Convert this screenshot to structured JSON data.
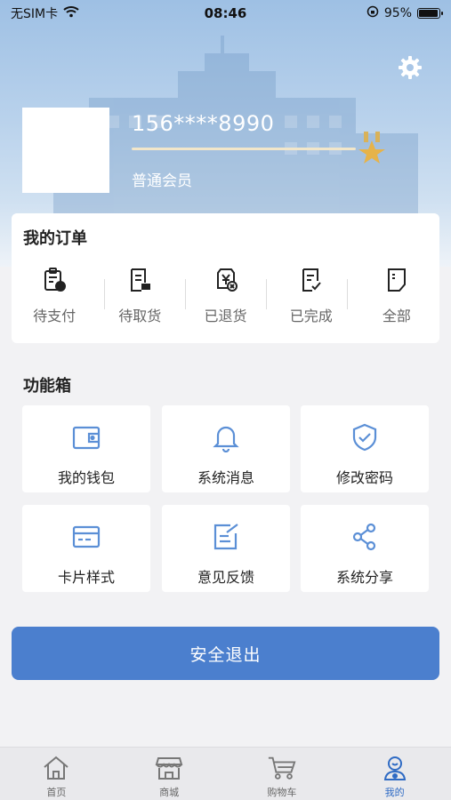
{
  "status_bar": {
    "carrier": "无SIM卡",
    "time": "08:46",
    "battery": "95%",
    "battery_level": 0.95
  },
  "profile": {
    "phone": "156****8990",
    "member_level": "普通会员"
  },
  "orders": {
    "title": "我的订单",
    "items": [
      {
        "label": "待支付",
        "icon": "pay-clipboard-icon"
      },
      {
        "label": "待取货",
        "icon": "pickup-list-icon"
      },
      {
        "label": "已退货",
        "icon": "refund-icon"
      },
      {
        "label": "已完成",
        "icon": "completed-doc-icon"
      },
      {
        "label": "全部",
        "icon": "all-doc-icon"
      }
    ]
  },
  "functions": {
    "title": "功能箱",
    "items": [
      {
        "label": "我的钱包",
        "icon": "wallet-icon"
      },
      {
        "label": "系统消息",
        "icon": "bell-icon"
      },
      {
        "label": "修改密码",
        "icon": "shield-check-icon"
      },
      {
        "label": "卡片样式",
        "icon": "card-icon"
      },
      {
        "label": "意见反馈",
        "icon": "feedback-edit-icon"
      },
      {
        "label": "系统分享",
        "icon": "share-icon"
      }
    ]
  },
  "logout_label": "安全退出",
  "tabs": [
    {
      "label": "首页",
      "icon": "home-icon",
      "active": false
    },
    {
      "label": "商城",
      "icon": "store-icon",
      "active": false
    },
    {
      "label": "购物车",
      "icon": "cart-icon",
      "active": false
    },
    {
      "label": "我的",
      "icon": "profile-icon",
      "active": true
    }
  ],
  "colors": {
    "accent": "#4b7fce",
    "active_tab": "#2f6bc4",
    "icon_blue": "#5b8fd6"
  }
}
